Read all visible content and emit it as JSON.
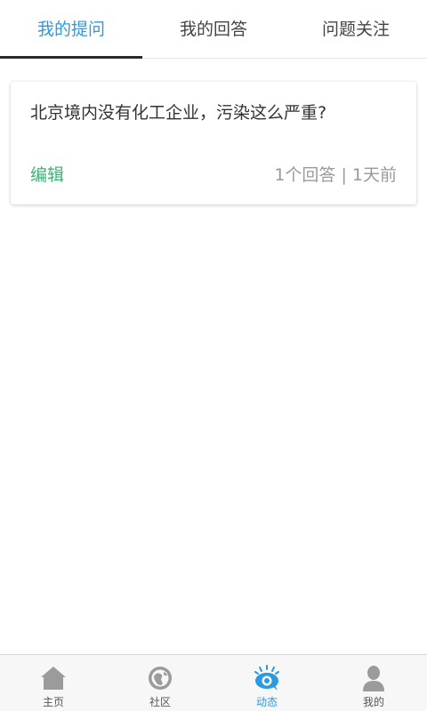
{
  "tabs": [
    {
      "label": "我的提问",
      "active": true
    },
    {
      "label": "我的回答",
      "active": false
    },
    {
      "label": "问题关注",
      "active": false
    }
  ],
  "questions": [
    {
      "title": "北京境内没有化工企业，污染这么严重?",
      "edit_label": "编辑",
      "meta": "1个回答 | 1天前"
    }
  ],
  "bottom_nav": [
    {
      "label": "主页",
      "icon": "home-icon",
      "active": false
    },
    {
      "label": "社区",
      "icon": "community-icon",
      "active": false
    },
    {
      "label": "动态",
      "icon": "activity-icon",
      "active": true
    },
    {
      "label": "我的",
      "icon": "profile-icon",
      "active": false
    }
  ],
  "colors": {
    "accent": "#2a9ae3",
    "edit": "#3cb371",
    "meta": "#9a9a9a",
    "icon_gray": "#9b9b9b"
  }
}
